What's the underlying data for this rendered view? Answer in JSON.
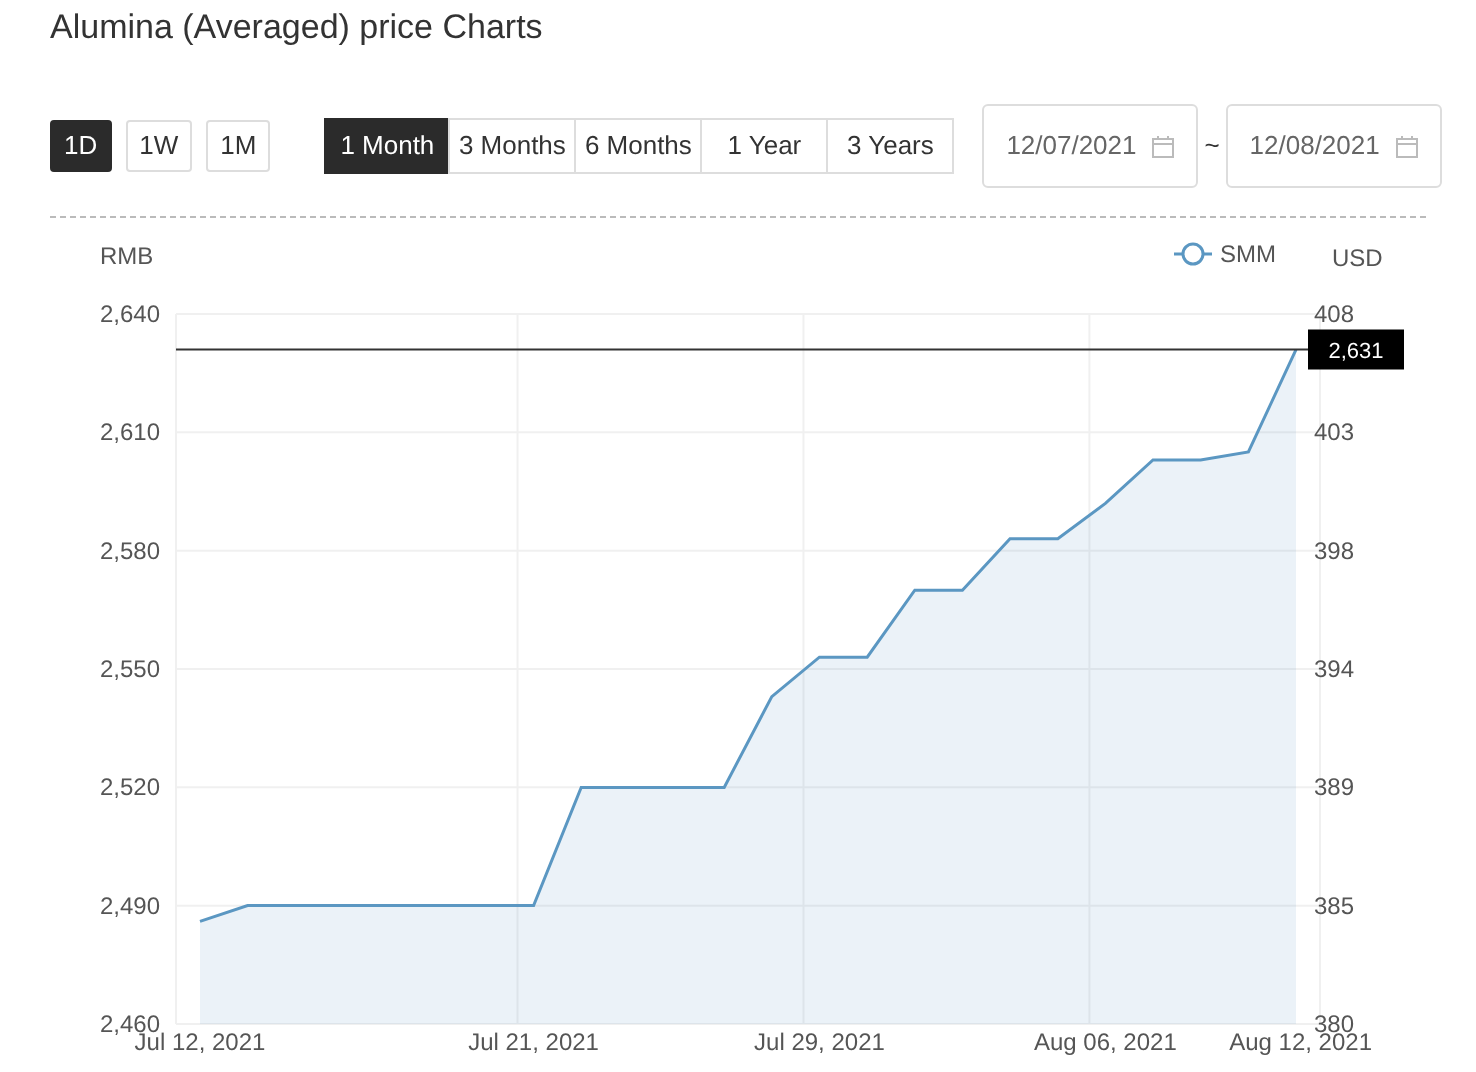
{
  "title": "Alumina (Averaged) price Charts",
  "interval_buttons": [
    {
      "label": "1D",
      "selected": true
    },
    {
      "label": "1W",
      "selected": false
    },
    {
      "label": "1M",
      "selected": false
    }
  ],
  "range_tabs": [
    {
      "label": "1 Month",
      "selected": true
    },
    {
      "label": "3 Months",
      "selected": false
    },
    {
      "label": "6 Months",
      "selected": false
    },
    {
      "label": "1 Year",
      "selected": false
    },
    {
      "label": "3 Years",
      "selected": false
    }
  ],
  "date_range": {
    "start": "12/07/2021",
    "separator": "~",
    "end": "12/08/2021"
  },
  "chart_data": {
    "type": "area",
    "ylabel": "RMB",
    "categories": [
      "Jul 12, 2021",
      null,
      null,
      null,
      null,
      null,
      null,
      "Jul 21, 2021",
      null,
      null,
      null,
      null,
      null,
      "Jul 29, 2021",
      null,
      null,
      null,
      null,
      null,
      "Aug 06, 2021",
      null,
      null,
      null,
      "Aug 12, 2021"
    ],
    "grid": true,
    "series": [
      {
        "name": "SMM",
        "color": "#5b97c2",
        "values": [
          2486,
          2490,
          2490,
          2490,
          2490,
          2490,
          2490,
          2490,
          2520,
          2520,
          2520,
          2520,
          2543,
          2553,
          2553,
          2570,
          2570,
          2583,
          2583,
          2592,
          2603,
          2603,
          2605,
          2631
        ]
      }
    ],
    "ylim": [
      2460,
      2640
    ],
    "yticks": [
      {
        "value": 2460,
        "label": "2,460"
      },
      {
        "value": 2490,
        "label": "2,490"
      },
      {
        "value": 2520,
        "label": "2,520"
      },
      {
        "value": 2550,
        "label": "2,550"
      },
      {
        "value": 2580,
        "label": "2,580"
      },
      {
        "value": 2610,
        "label": "2,610"
      },
      {
        "value": 2640,
        "label": "2,640"
      }
    ],
    "ref_lines": [
      {
        "axis": "y",
        "value": 2631,
        "label": "2,631"
      }
    ]
  },
  "right_axis": {
    "label": "USD",
    "ticks": [
      "408",
      "403",
      "398",
      "394",
      "389",
      "385",
      "380"
    ]
  }
}
